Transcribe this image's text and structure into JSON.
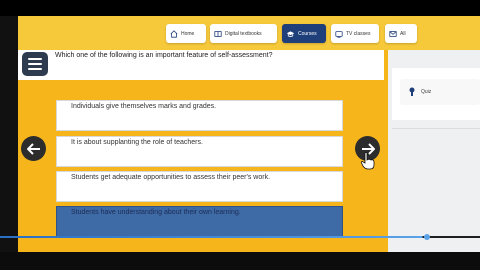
{
  "nav": {
    "items": [
      {
        "label": "Home",
        "icon": "home-icon"
      },
      {
        "label": "Digital textbooks",
        "icon": "book-icon"
      },
      {
        "label": "Courses",
        "icon": "graduation-cap-icon"
      },
      {
        "label": "TV classes",
        "icon": "tv-icon"
      },
      {
        "label": "All",
        "icon": "mail-icon"
      }
    ],
    "active": "Courses"
  },
  "question": {
    "text": "Which one of the following is an important feature of self-assessment?",
    "options": [
      "Individuals give themselves marks and grades.",
      "It is about supplanting the role of teachers.",
      "Students get adequate opportunities to assess their peer's work.",
      "Students have understanding about their own learning."
    ],
    "selected_index": 3
  },
  "sidebar": {
    "items": [
      {
        "label": "Quiz",
        "icon": "quiz-icon"
      }
    ]
  },
  "colors": {
    "primary_yellow": "#f7b51c",
    "nav_active": "#1f3f7a",
    "selected_option": "#3e6aa6"
  }
}
